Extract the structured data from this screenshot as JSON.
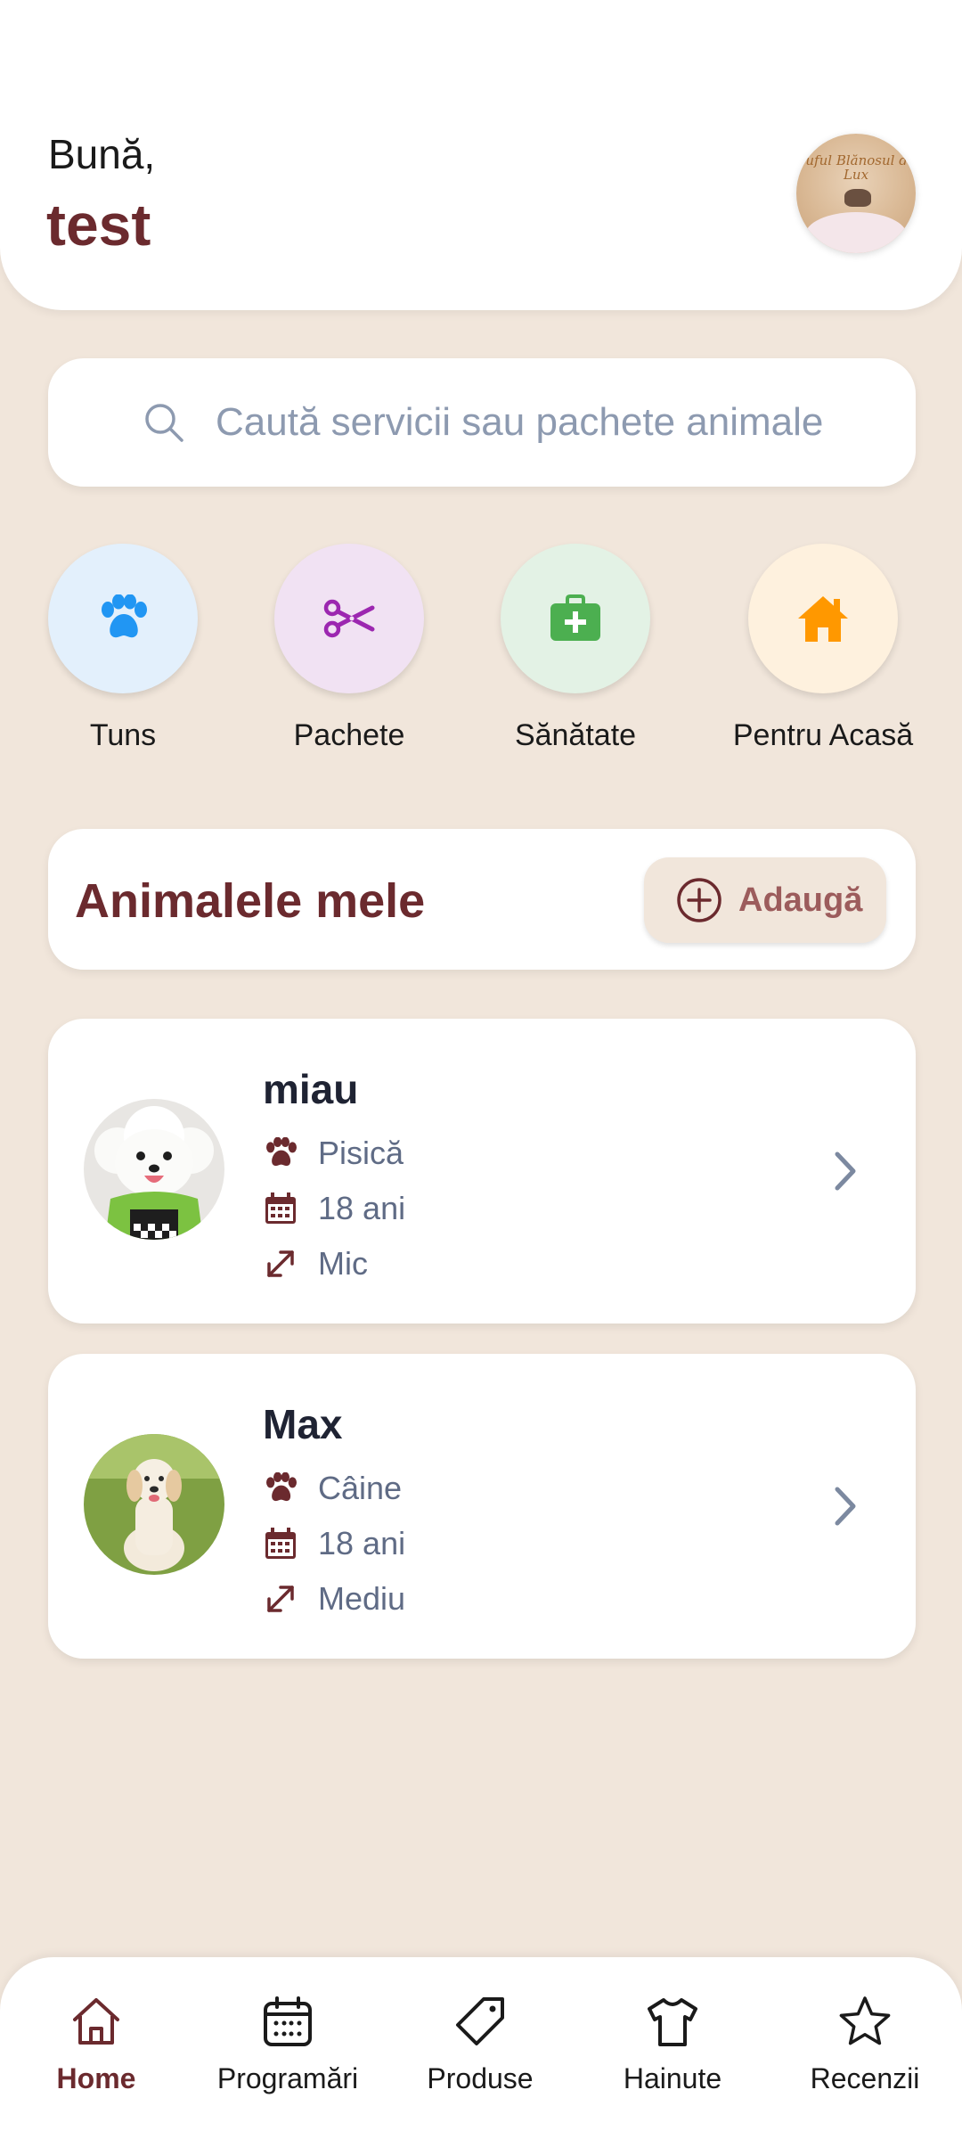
{
  "header": {
    "greeting": "Bună,",
    "username": "test",
    "avatar_logo_text": "Puful Blănosul de Lux"
  },
  "search": {
    "placeholder": "Caută servicii sau pachete animale",
    "value": ""
  },
  "categories": [
    {
      "label": "Tuns",
      "icon": "paw-icon",
      "bg": "#E3F0FC",
      "color": "#2196F3"
    },
    {
      "label": "Pachete",
      "icon": "scissors-icon",
      "bg": "#F1E2F3",
      "color": "#9C27B0"
    },
    {
      "label": "Sănătate",
      "icon": "medkit-icon",
      "bg": "#E3F2E5",
      "color": "#4CAF50"
    },
    {
      "label": "Pentru Acasă",
      "icon": "home-icon",
      "bg": "#FEF1DE",
      "color": "#FF9800"
    }
  ],
  "my_pets": {
    "title": "Animalele mele",
    "add_label": "Adaugă"
  },
  "pets": [
    {
      "name": "miau",
      "type": "Pisică",
      "age": "18 ani",
      "size": "Mic"
    },
    {
      "name": "Max",
      "type": "Câine",
      "age": "18 ani",
      "size": "Mediu"
    }
  ],
  "nav": [
    {
      "label": "Home",
      "icon": "home-icon",
      "active": true
    },
    {
      "label": "Programări",
      "icon": "calendar-icon",
      "active": false
    },
    {
      "label": "Produse",
      "icon": "tag-icon",
      "active": false
    },
    {
      "label": "Hainute",
      "icon": "shirt-icon",
      "active": false
    },
    {
      "label": "Recenzii",
      "icon": "star-icon",
      "active": false
    }
  ],
  "colors": {
    "background": "#F1E6DB",
    "brand": "#6B2A2E",
    "muted_text": "#5F6B85",
    "placeholder": "#8D9AB0"
  }
}
